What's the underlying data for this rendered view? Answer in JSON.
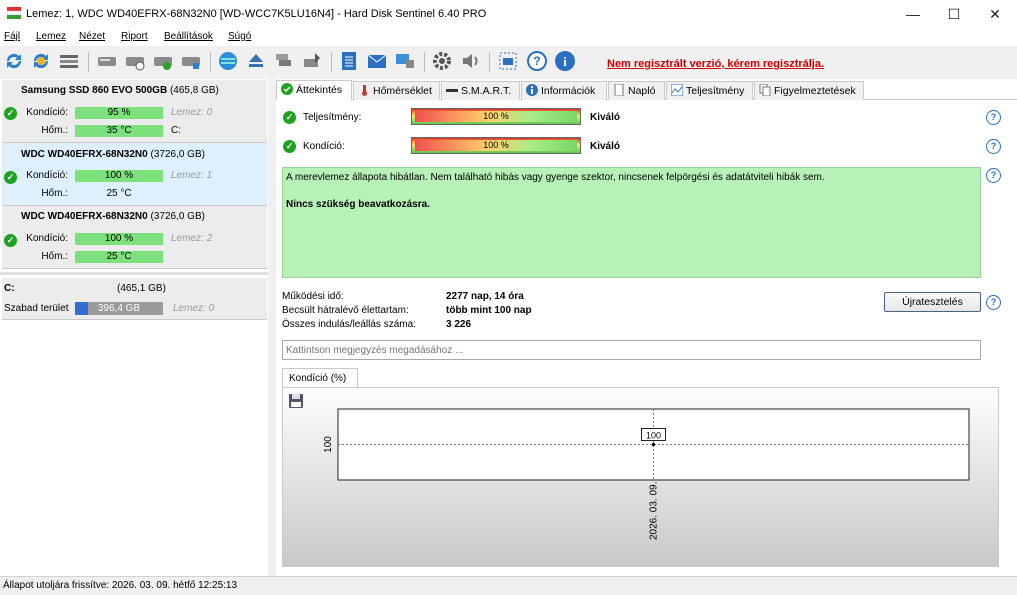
{
  "window": {
    "title": "Lemez: 1, WDC WD40EFRX-68N32N0 [WD-WCC7K5LU16N4]  -  Hard Disk Sentinel 6.40 PRO",
    "controls": {
      "minimize": "—",
      "maximize": "☐",
      "close": "✕"
    }
  },
  "menu": [
    "Fájl",
    "Lemez",
    "Nézet",
    "Riport",
    "Beállítások",
    "Súgó"
  ],
  "toolbar": {
    "icons": [
      "refresh-icon",
      "refresh-alt-icon",
      "disk-list-icon",
      "drive-icon",
      "drive-clock-icon",
      "drive-ok-icon",
      "drive-info-icon",
      "globe-icon",
      "eject-icon",
      "disk-stack-icon",
      "disk-export-icon",
      "notepad-icon",
      "mail-icon",
      "network-icon",
      "settings-icon",
      "speaker-icon",
      "screenshot-icon",
      "help-icon",
      "info-icon"
    ],
    "registration_warning": "Nem regisztrált verzió, kérem regisztrálja."
  },
  "disks": [
    {
      "name": "Samsung SSD 860 EVO 500GB",
      "size": "(465,8 GB)",
      "condition_label": "Kondíció:",
      "condition": "95 %",
      "drive_label": "Lemez: 0",
      "temp_label": "Hőm.:",
      "temp": "35 °C",
      "partition": "C:"
    },
    {
      "name": "WDC WD40EFRX-68N32N0",
      "size": "(3726,0 GB)",
      "condition_label": "Kondíció:",
      "condition": "100 %",
      "drive_label": "Lemez: 1",
      "temp_label": "Hőm.:",
      "temp": "25 °C"
    },
    {
      "name": "WDC WD40EFRX-68N32N0",
      "size": "(3726,0 GB)",
      "condition_label": "Kondíció:",
      "condition": "100 %",
      "drive_label": "Lemez: 2",
      "temp_label": "Hőm.:",
      "temp": "25 °C"
    }
  ],
  "volume": {
    "letter": "C:",
    "size": "(465,1 GB)",
    "free_label": "Szabad terület",
    "free": "396,4 GB",
    "drive_label": "Lemez: 0",
    "free_fraction": 0.85
  },
  "tabs": [
    "Áttekintés",
    "Hőmérséklet",
    "S.M.A.R.T.",
    "Információk",
    "Napló",
    "Teljesítmény",
    "Figyelmeztetések"
  ],
  "overview": {
    "performance_label": "Teljesítmény:",
    "performance_value": "100 %",
    "performance_rating": "Kiváló",
    "condition_label": "Kondíció:",
    "condition_value": "100 %",
    "condition_rating": "Kiváló",
    "status_text": "A merevlemez állapota hibátlan. Nem található hibás vagy gyenge szektor, nincsenek felpörgési és adatátviteli hibák sem.",
    "status_action": "Nincs szükség beavatkozásra.",
    "power_on_label": "Működési idő:",
    "power_on_value": "2277 nap, 14 óra",
    "lifetime_label": "Becsült hátralévő élettartam:",
    "lifetime_value": "több mint 100 nap",
    "starts_label": "Összes indulás/leállás száma:",
    "starts_value": "3 226",
    "retest_button": "Újratesztelés",
    "note_placeholder": "Kattintson megjegyzés megadásához ..."
  },
  "chart_tab": "Kondíció  (%)",
  "chart_data": {
    "type": "line",
    "x": [
      "2026. 03. 09."
    ],
    "series": [
      {
        "values": [
          100
        ]
      }
    ],
    "ytick": "100",
    "xtick": "2026. 03. 09.",
    "point_label": "100"
  },
  "statusbar": {
    "text": "Állapot utoljára frissítve: 2026. 03. 09. hétfő 12:25:13"
  }
}
